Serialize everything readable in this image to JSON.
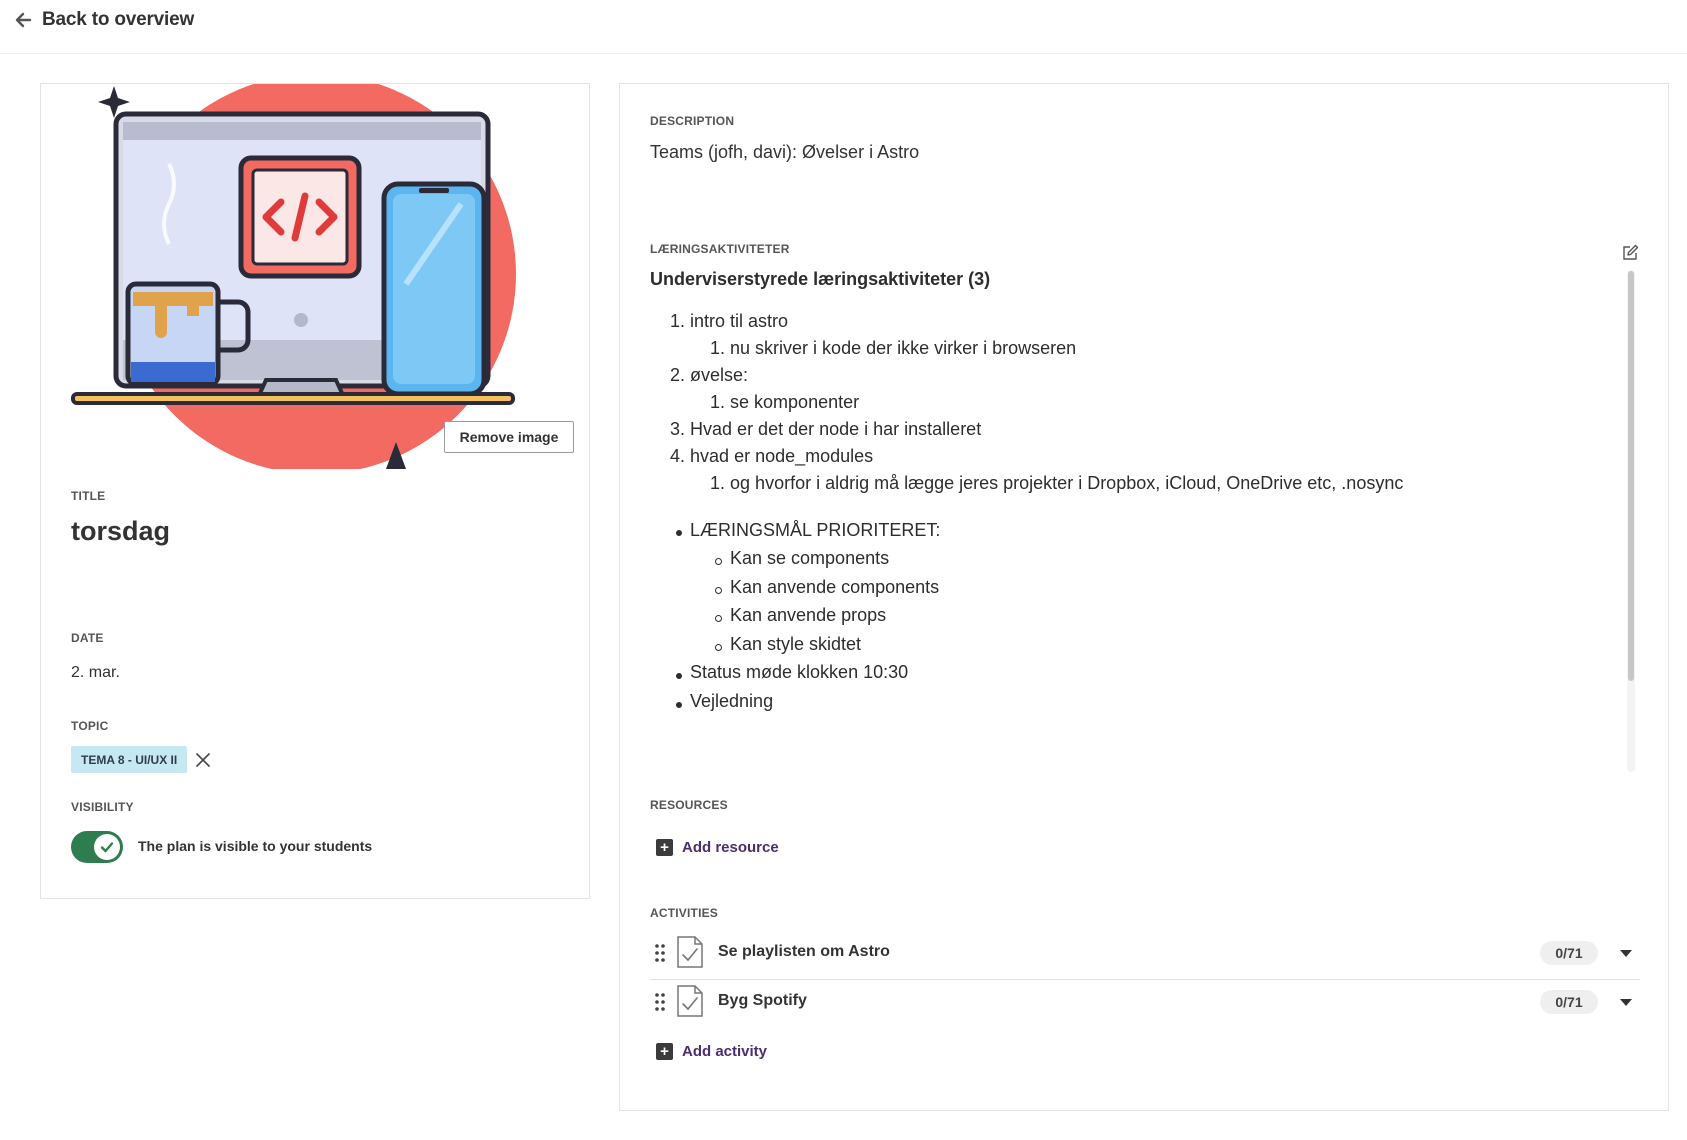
{
  "header": {
    "back_label": "Back to overview"
  },
  "plan": {
    "image_button": "Remove image",
    "title_label": "TITLE",
    "title": "torsdag",
    "date_label": "DATE",
    "date": "2. mar.",
    "topic_label": "TOPIC",
    "topic_chip": "TEMA 8 - UI/UX II",
    "visibility_label": "VISIBILITY",
    "visibility_on": true,
    "visibility_text": "The plan is visible to your students"
  },
  "description": {
    "label": "DESCRIPTION",
    "text": "Teams (jofh, davi): Øvelser i Astro"
  },
  "learning": {
    "label": "LÆRINGSAKTIVITETER",
    "heading": "Underviserstyrede læringsaktiviteter (3)",
    "ordered": [
      {
        "num": "1.",
        "text": "intro til astro"
      },
      {
        "num": "1.",
        "text": "nu skriver i kode der ikke virker i browseren"
      },
      {
        "num": "2.",
        "text": "øvelse:"
      },
      {
        "num": "1.",
        "text": "se komponenter"
      },
      {
        "num": "3.",
        "text": "Hvad er det der node i har installeret"
      },
      {
        "num": "4.",
        "text": "hvad er node_modules"
      },
      {
        "num": "1.",
        "text": "og hvorfor i aldrig må lægge jeres projekter i Dropbox, iCloud, OneDrive etc, .nosync"
      }
    ],
    "bullets": [
      "LÆRINGSMÅL PRIORITERET:",
      "Kan se components",
      "Kan anvende components",
      "Kan anvende props",
      "Kan style skidtet",
      "Status møde klokken 10:30",
      "Vejledning"
    ]
  },
  "resources": {
    "label": "RESOURCES",
    "add_label": "Add resource"
  },
  "activities": {
    "label": "ACTIVITIES",
    "items": [
      {
        "name": "Se playlisten om Astro",
        "count": "0/71"
      },
      {
        "name": "Byg Spotify",
        "count": "0/71"
      }
    ],
    "add_label": "Add activity"
  },
  "colors": {
    "toggle_on": "#2e7d4f",
    "chip_bg": "#c5e8f2",
    "link": "#4a2d73",
    "illustration_circle": "#f26a62"
  }
}
